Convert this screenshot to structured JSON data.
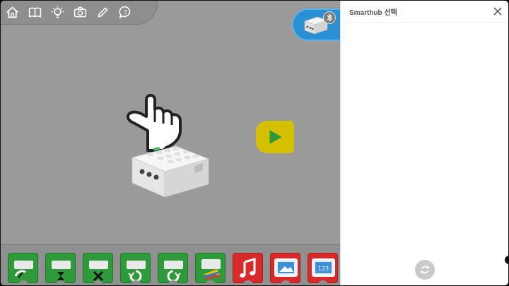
{
  "toolbar": {
    "items": [
      "home",
      "book",
      "lightbulb",
      "camera",
      "pencil",
      "help"
    ]
  },
  "panel": {
    "title": "Smarthub 선택"
  },
  "palette": {
    "blocks": [
      {
        "icon": "motor-power-icon",
        "color": "green"
      },
      {
        "icon": "motor-time-icon",
        "color": "green"
      },
      {
        "icon": "motor-stop-icon",
        "color": "green"
      },
      {
        "icon": "motor-counterclockwise-icon",
        "color": "green"
      },
      {
        "icon": "motor-clockwise-icon",
        "color": "green"
      },
      {
        "icon": "light-icon",
        "color": "green"
      },
      {
        "icon": "music-note-icon",
        "color": "red"
      },
      {
        "icon": "display-image-icon",
        "color": "red"
      },
      {
        "icon": "display-number-icon",
        "color": "red"
      }
    ],
    "number_label": "123"
  },
  "colors": {
    "canvas": "#9a9a9a",
    "accent_blue": "#2a8fd3",
    "play_yellow": "#d4c000",
    "block_green": "#2e9a3a",
    "block_red": "#d82a2a"
  }
}
